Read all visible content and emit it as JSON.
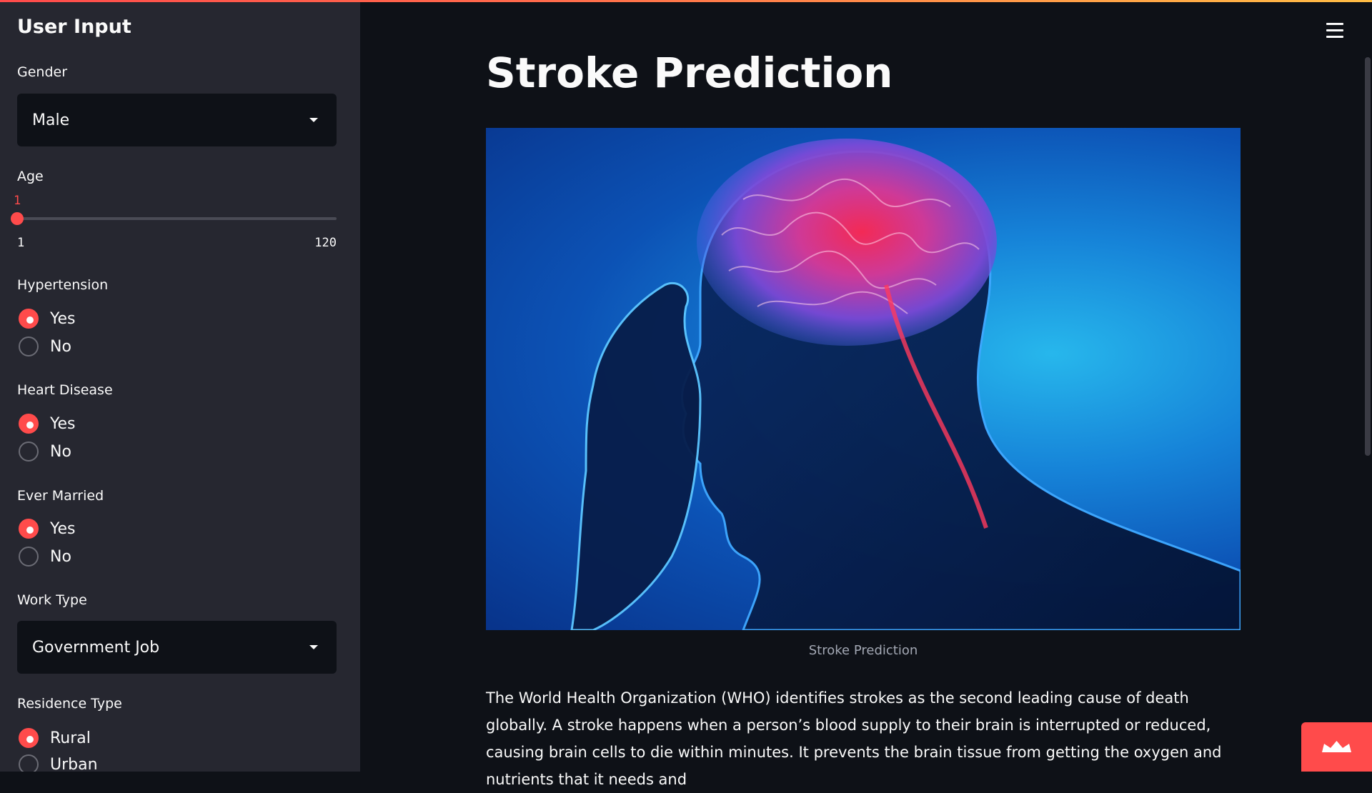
{
  "sidebar": {
    "title": "User Input",
    "gender": {
      "label": "Gender",
      "value": "Male"
    },
    "age": {
      "label": "Age",
      "value": 1,
      "min": 1,
      "max": 120,
      "value_text": "1",
      "min_text": "1",
      "max_text": "120"
    },
    "hypertension": {
      "label": "Hypertension",
      "options": [
        "Yes",
        "No"
      ],
      "selected": "Yes"
    },
    "heart_disease": {
      "label": "Heart Disease",
      "options": [
        "Yes",
        "No"
      ],
      "selected": "Yes"
    },
    "ever_married": {
      "label": "Ever Married",
      "options": [
        "Yes",
        "No"
      ],
      "selected": "Yes"
    },
    "work_type": {
      "label": "Work Type",
      "value": "Government Job"
    },
    "residence_type": {
      "label": "Residence Type",
      "options": [
        "Rural",
        "Urban"
      ],
      "selected": "Rural"
    }
  },
  "main": {
    "title": "Stroke Prediction",
    "image_caption": "Stroke Prediction",
    "paragraph": "The World Health Organization (WHO) identifies strokes as the second leading cause of death globally. A stroke happens when a person’s blood supply to their brain is interrupted or reduced, causing brain cells to die within minutes. It prevents the brain tissue from getting the oxygen and nutrients that it needs and"
  },
  "icons": {
    "menu": "hamburger-menu-icon",
    "badge": "crown-icon"
  },
  "colors": {
    "accent": "#ff4b4b",
    "sidebar_bg": "#262730",
    "main_bg": "#0e1117"
  }
}
